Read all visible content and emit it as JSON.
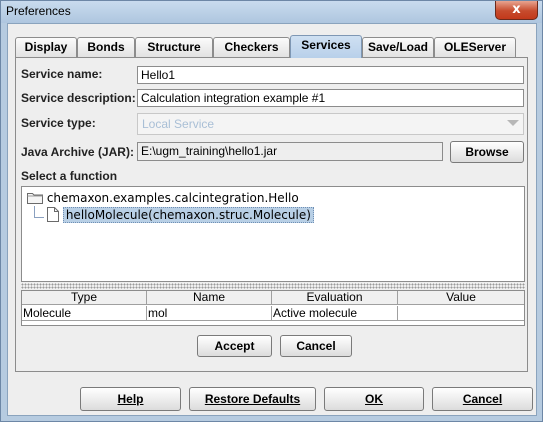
{
  "window": {
    "title": "Preferences",
    "close_glyph": "x"
  },
  "tabs": [
    {
      "label": "Display",
      "active": false
    },
    {
      "label": "Bonds",
      "active": false
    },
    {
      "label": "Structure",
      "active": false
    },
    {
      "label": "Checkers",
      "active": false
    },
    {
      "label": "Services",
      "active": true
    },
    {
      "label": "Save/Load",
      "active": false
    },
    {
      "label": "OLEServer",
      "active": false
    }
  ],
  "form": {
    "service_name_label": "Service name:",
    "service_name_value": "Hello1",
    "service_description_label": "Service description:",
    "service_description_value": "Calculation integration example #1",
    "service_type_label": "Service type:",
    "service_type_value": "Local Service",
    "jar_label": "Java Archive (JAR):",
    "jar_value": "E:\\ugm_training\\hello1.jar",
    "browse_label": "Browse",
    "select_function_label": "Select a function"
  },
  "tree": {
    "root": "chemaxon.examples.calcintegration.Hello",
    "child": "helloMolecule(chemaxon.struc.Molecule)"
  },
  "table": {
    "columns": [
      "Type",
      "Name",
      "Evaluation",
      "Value"
    ],
    "rows": [
      [
        "Molecule",
        "mol",
        "Active molecule",
        ""
      ]
    ]
  },
  "panel_buttons": {
    "accept": "Accept",
    "cancel": "Cancel"
  },
  "footer": {
    "help": "Help",
    "restore": "Restore Defaults",
    "ok": "OK",
    "cancel": "Cancel"
  },
  "colors": {
    "frame": "#b6cbe0",
    "active_tab": "#b8d0ea",
    "selection": "#b8cfe5",
    "disabled_text": "#a9bfd6"
  }
}
